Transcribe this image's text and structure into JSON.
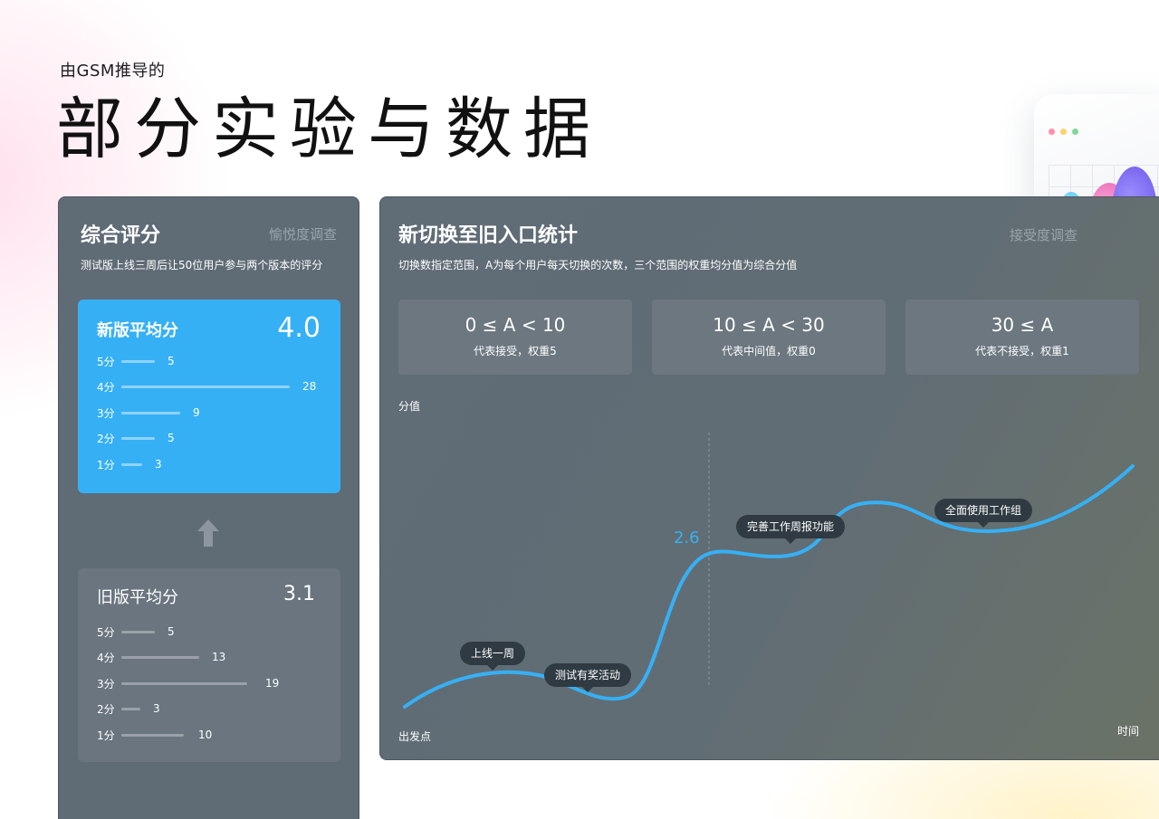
{
  "header": {
    "subtitle": "由GSM推导的",
    "title": "部分实验与数据"
  },
  "left_panel": {
    "title": "综合评分",
    "tag": "愉悦度调查",
    "description": "测试版上线三周后让50位用户参与两个版本的评分",
    "new_version": {
      "label": "新版平均分",
      "score": "4.0",
      "distribution": [
        {
          "label": "5分",
          "count": 5
        },
        {
          "label": "4分",
          "count": 28
        },
        {
          "label": "3分",
          "count": 9
        },
        {
          "label": "2分",
          "count": 5
        },
        {
          "label": "1分",
          "count": 3
        }
      ]
    },
    "old_version": {
      "label": "旧版平均分",
      "score": "3.1",
      "distribution": [
        {
          "label": "5分",
          "count": 5
        },
        {
          "label": "4分",
          "count": 13
        },
        {
          "label": "3分",
          "count": 19
        },
        {
          "label": "2分",
          "count": 3
        },
        {
          "label": "1分",
          "count": 10
        }
      ]
    }
  },
  "main_panel": {
    "title": "新切换至旧入口统计",
    "tag": "接受度调查",
    "description": "切换数指定范围，A为每个用户每天切换的次数，三个范围的权重均分值为综合分值",
    "ranges": [
      {
        "label": "0 ≤ A < 10",
        "note": "代表接受，权重5"
      },
      {
        "label": "10 ≤ A < 30",
        "note": "代表中间值，权重0"
      },
      {
        "label": "30 ≤ A",
        "note": "代表不接受，权重1"
      }
    ],
    "chart": {
      "y_label": "分值",
      "x_start": "出发点",
      "x_end": "时间",
      "value_label": "2.6",
      "line_color": "#36b0f5",
      "events": [
        "上线一周",
        "测试有奖活动",
        "完善工作周报功能",
        "全面使用工作组"
      ]
    }
  },
  "colors": {
    "panel": "#5f6b75",
    "accent": "#36b0f5",
    "label_bg": "#2f3a42"
  }
}
